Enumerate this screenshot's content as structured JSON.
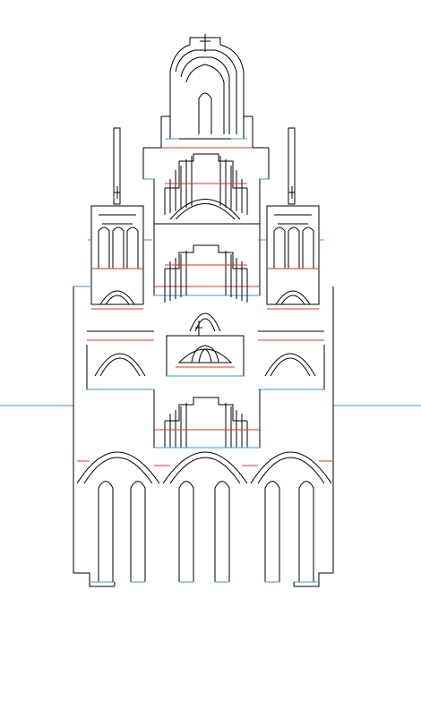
{
  "image": {
    "subject": "church-facade-cut-template",
    "line_colors": {
      "cut": "#000000",
      "mountain_fold": "#d9342b",
      "valley_fold": "#3a9bd5"
    }
  }
}
